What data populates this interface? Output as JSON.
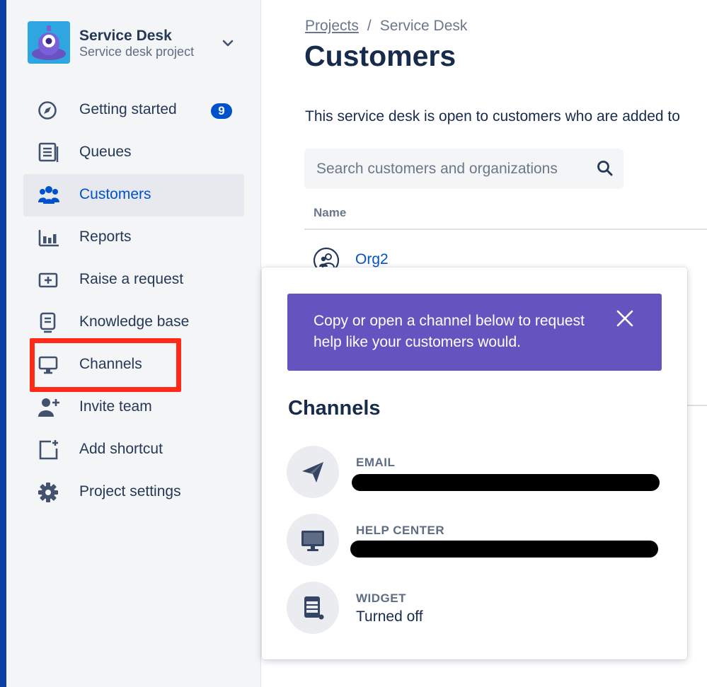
{
  "project": {
    "name": "Service Desk",
    "type": "Service desk project"
  },
  "sidebar": {
    "items": [
      {
        "label": "Getting started",
        "icon": "compass-icon",
        "badge": "9"
      },
      {
        "label": "Queues",
        "icon": "queues-icon"
      },
      {
        "label": "Customers",
        "icon": "people-icon",
        "active": true
      },
      {
        "label": "Reports",
        "icon": "reports-icon"
      },
      {
        "label": "Raise a request",
        "icon": "raise-request-icon"
      },
      {
        "label": "Knowledge base",
        "icon": "knowledge-base-icon"
      },
      {
        "label": "Channels",
        "icon": "monitor-icon",
        "highlighted": true
      },
      {
        "label": "Invite team",
        "icon": "invite-user-icon"
      },
      {
        "label": "Add shortcut",
        "icon": "add-shortcut-icon"
      },
      {
        "label": "Project settings",
        "icon": "gear-icon"
      }
    ]
  },
  "breadcrumbs": {
    "link": "Projects",
    "separator": "/",
    "current": "Service Desk"
  },
  "page": {
    "title": "Customers",
    "intro": "This service desk is open to customers who are added to"
  },
  "search": {
    "placeholder": "Search customers and organizations"
  },
  "table": {
    "column_name": "Name",
    "rows": [
      {
        "name": "Org2",
        "icon": "organization-icon"
      }
    ]
  },
  "popup": {
    "banner_text": "Copy or open a channel below to request help like your customers would.",
    "title": "Channels",
    "channels": [
      {
        "label": "EMAIL",
        "icon": "paper-plane-icon",
        "value": "",
        "redacted": true
      },
      {
        "label": "HELP CENTER",
        "icon": "monitor-icon",
        "value": "",
        "redacted": true
      },
      {
        "label": "WIDGET",
        "icon": "widget-icon",
        "value": "Turned off",
        "redacted": false
      }
    ]
  },
  "colors": {
    "accent": "#0052CC",
    "banner": "#6554C0",
    "highlight": "#FF2A1A",
    "sidebar_bg": "#F4F5F7"
  }
}
